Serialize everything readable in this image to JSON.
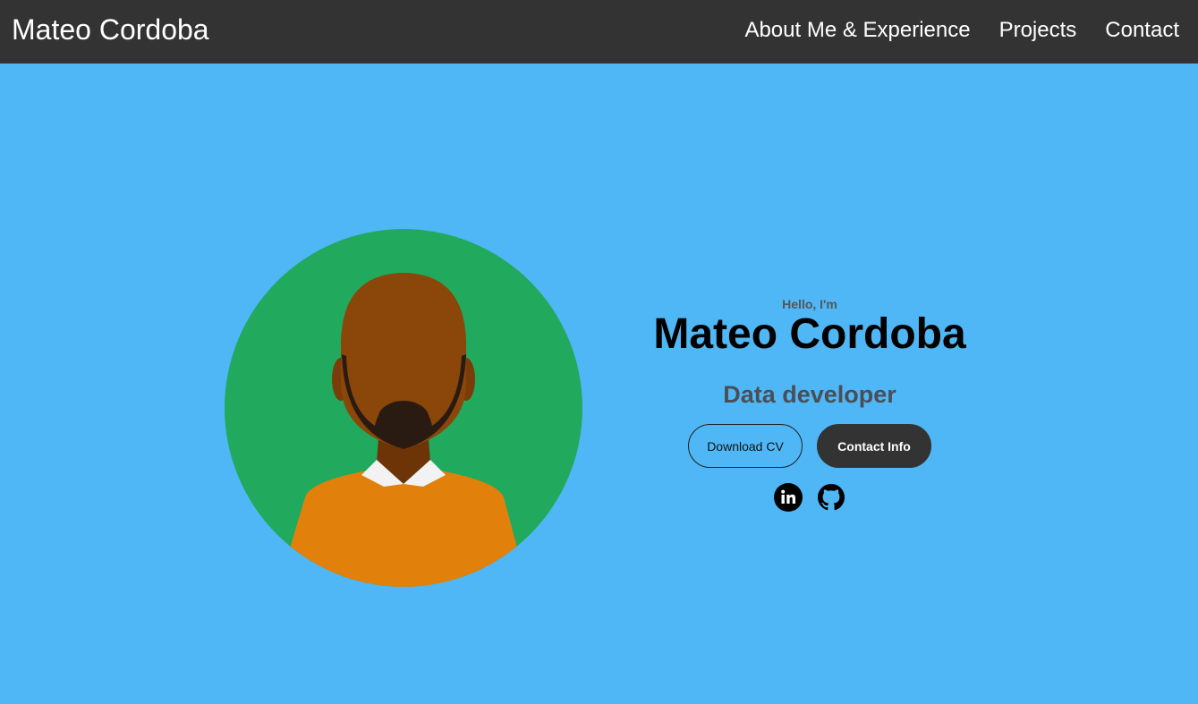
{
  "nav": {
    "brand": "Mateo Cordoba",
    "links": [
      "About Me & Experience",
      "Projects",
      "Contact"
    ]
  },
  "hero": {
    "greeting": "Hello, I'm",
    "name": "Mateo Cordoba",
    "role": "Data developer",
    "buttons": {
      "download_cv": "Download CV",
      "contact_info": "Contact Info"
    },
    "socials": [
      "linkedin-icon",
      "github-icon"
    ]
  },
  "colors": {
    "background": "#4fb7f5",
    "navbar": "#333333",
    "avatar_circle": "#21a95e",
    "shirt": "#e2800c",
    "skin": "#8b4609"
  }
}
